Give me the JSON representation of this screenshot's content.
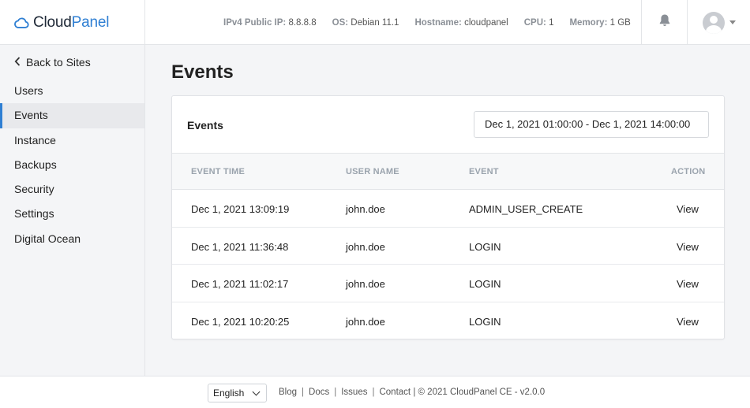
{
  "header": {
    "logo": {
      "part1": "Cloud",
      "part2": "Panel"
    },
    "sysinfo": [
      {
        "key": "IPv4 Public IP:",
        "value": "8.8.8.8"
      },
      {
        "key": "OS:",
        "value": "Debian 11.1"
      },
      {
        "key": "Hostname:",
        "value": "cloudpanel"
      },
      {
        "key": "CPU:",
        "value": "1"
      },
      {
        "key": "Memory:",
        "value": "1 GB"
      }
    ],
    "bell_icon": "bell-icon",
    "avatar_icon": "user-avatar"
  },
  "sidebar": {
    "back_label": "Back to Sites",
    "items": [
      {
        "label": "Users",
        "active": false
      },
      {
        "label": "Events",
        "active": true
      },
      {
        "label": "Instance",
        "active": false
      },
      {
        "label": "Backups",
        "active": false
      },
      {
        "label": "Security",
        "active": false
      },
      {
        "label": "Settings",
        "active": false
      },
      {
        "label": "Digital Ocean",
        "active": false
      }
    ]
  },
  "main": {
    "page_title": "Events",
    "card_title": "Events",
    "date_range": "Dec 1, 2021 01:00:00 - Dec 1, 2021 14:00:00",
    "columns": [
      "EVENT TIME",
      "USER NAME",
      "EVENT",
      "ACTION"
    ],
    "rows": [
      {
        "time": "Dec 1, 2021 13:09:19",
        "user": "john.doe",
        "event": "ADMIN_USER_CREATE",
        "action": "View"
      },
      {
        "time": "Dec 1, 2021 11:36:48",
        "user": "john.doe",
        "event": "LOGIN",
        "action": "View"
      },
      {
        "time": "Dec 1, 2021 11:02:17",
        "user": "john.doe",
        "event": "LOGIN",
        "action": "View"
      },
      {
        "time": "Dec 1, 2021 10:20:25",
        "user": "john.doe",
        "event": "LOGIN",
        "action": "View"
      }
    ]
  },
  "footer": {
    "language": "English",
    "links": [
      "Blog",
      "Docs",
      "Issues",
      "Contact"
    ],
    "copyright": "| © 2021 CloudPanel CE - v2.0.0"
  },
  "colors": {
    "accent": "#2f7fd3",
    "background": "#f4f5f7"
  }
}
